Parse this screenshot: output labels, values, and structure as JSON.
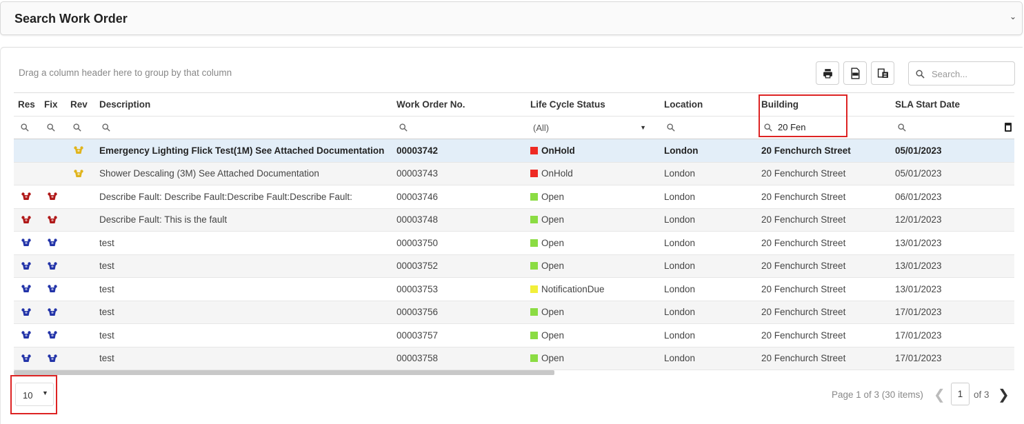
{
  "panel": {
    "title": "Search Work Order"
  },
  "toolbar": {
    "group_hint": "Drag a column header here to group by that column",
    "search_placeholder": "Search..."
  },
  "columns": [
    "Res",
    "Fix",
    "Rev",
    "Description",
    "Work Order No.",
    "Life Cycle Status",
    "Location",
    "Building",
    "SLA Start Date"
  ],
  "filters": {
    "status": "(All)",
    "building": "20 Fen"
  },
  "colors": {
    "onhold": "#ee2a24",
    "open": "#8bdc43",
    "notification_due": "#f2ef3a",
    "highlight": "#dd2222",
    "selected_row": "#e3eef8"
  },
  "rows": [
    {
      "res": "",
      "fix": "",
      "rev": "yellow-pin-icon",
      "description": "Emergency Lighting Flick Test(1M) See Attached Documentation",
      "wo": "00003742",
      "status": "OnHold",
      "status_color": "#ee2a24",
      "location": "London",
      "building": "20 Fenchurch Street",
      "sla": "05/01/2023",
      "selected": true
    },
    {
      "res": "",
      "fix": "",
      "rev": "yellow-pin-icon",
      "description": "Shower Descaling (3M) See Attached Documentation",
      "wo": "00003743",
      "status": "OnHold",
      "status_color": "#ee2a24",
      "location": "London",
      "building": "20 Fenchurch Street",
      "sla": "05/01/2023"
    },
    {
      "res": "red-pin-icon",
      "fix": "red-pin-icon",
      "rev": "",
      "description": "Describe Fault: Describe Fault:Describe Fault:Describe Fault:",
      "wo": "00003746",
      "status": "Open",
      "status_color": "#8bdc43",
      "location": "London",
      "building": "20 Fenchurch Street",
      "sla": "06/01/2023"
    },
    {
      "res": "red-pin-icon",
      "fix": "red-pin-icon",
      "rev": "",
      "description": "Describe Fault: This is the fault",
      "wo": "00003748",
      "status": "Open",
      "status_color": "#8bdc43",
      "location": "London",
      "building": "20 Fenchurch Street",
      "sla": "12/01/2023"
    },
    {
      "res": "blue-pin-icon",
      "fix": "blue-pin-icon",
      "rev": "",
      "description": "test",
      "wo": "00003750",
      "status": "Open",
      "status_color": "#8bdc43",
      "location": "London",
      "building": "20 Fenchurch Street",
      "sla": "13/01/2023"
    },
    {
      "res": "blue-pin-icon",
      "fix": "blue-pin-icon",
      "rev": "",
      "description": "test",
      "wo": "00003752",
      "status": "Open",
      "status_color": "#8bdc43",
      "location": "London",
      "building": "20 Fenchurch Street",
      "sla": "13/01/2023"
    },
    {
      "res": "blue-pin-icon",
      "fix": "blue-pin-icon",
      "rev": "",
      "description": "test",
      "wo": "00003753",
      "status": "NotificationDue",
      "status_color": "#f2ef3a",
      "location": "London",
      "building": "20 Fenchurch Street",
      "sla": "13/01/2023"
    },
    {
      "res": "blue-pin-icon",
      "fix": "blue-pin-icon",
      "rev": "",
      "description": "test",
      "wo": "00003756",
      "status": "Open",
      "status_color": "#8bdc43",
      "location": "London",
      "building": "20 Fenchurch Street",
      "sla": "17/01/2023"
    },
    {
      "res": "blue-pin-icon",
      "fix": "blue-pin-icon",
      "rev": "",
      "description": "test",
      "wo": "00003757",
      "status": "Open",
      "status_color": "#8bdc43",
      "location": "London",
      "building": "20 Fenchurch Street",
      "sla": "17/01/2023"
    },
    {
      "res": "blue-pin-icon",
      "fix": "blue-pin-icon",
      "rev": "",
      "description": "test",
      "wo": "00003758",
      "status": "Open",
      "status_color": "#8bdc43",
      "location": "London",
      "building": "20 Fenchurch Street",
      "sla": "17/01/2023"
    }
  ],
  "pager": {
    "page_size": "10",
    "info": "Page 1 of 3 (30 items)",
    "current": "1",
    "of_label": "of 3"
  }
}
